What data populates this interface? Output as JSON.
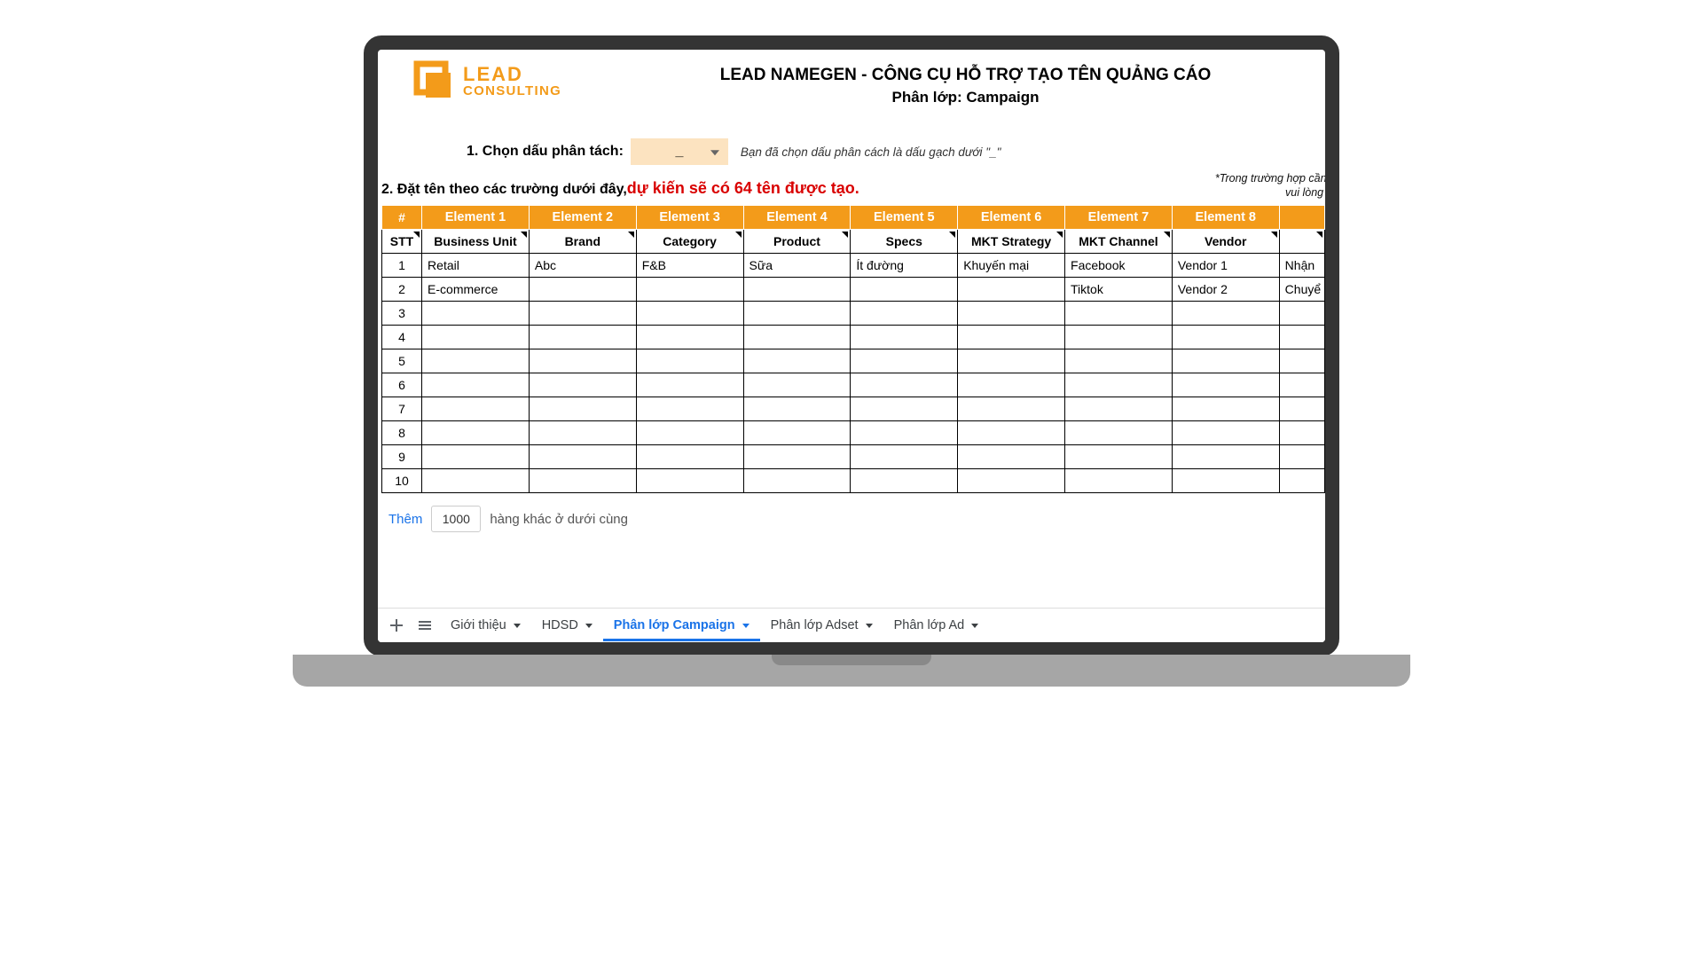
{
  "brand": {
    "line1": "LEAD",
    "line2": "CONSULTING"
  },
  "header": {
    "title": "LEAD NAMEGEN - CÔNG CỤ HỖ TRỢ TẠO TÊN QUẢNG CÁO",
    "subtitle": "Phân lớp: Campaign"
  },
  "step1": {
    "label": "1. Chọn dấu phân tách:",
    "separator_value": "_",
    "hint": "Bạn đã chọn dấu phân cách là dấu gạch dưới \"_\""
  },
  "step2": {
    "label": "2. Đặt tên theo các trường dưới đây, ",
    "highlight": "dự kiến sẽ có 64 tên được tạo.",
    "note_line1": "*Trong trường hợp cần p",
    "note_line2": "vui lòng th"
  },
  "table": {
    "header_hash": "#",
    "header_elements": [
      "Element 1",
      "Element 2",
      "Element 3",
      "Element 4",
      "Element 5",
      "Element 6",
      "Element 7",
      "Element 8",
      ""
    ],
    "header_stt": "STT",
    "header_fields": [
      "Business Unit",
      "Brand",
      "Category",
      "Product",
      "Specs",
      "MKT Strategy",
      "MKT Channel",
      "Vendor",
      ""
    ],
    "rows": [
      {
        "stt": "1",
        "cells": [
          "Retail",
          "Abc",
          "F&B",
          "Sữa",
          "Ít đường",
          "Khuyến mại",
          "Facebook",
          "Vendor 1",
          "Nhận "
        ]
      },
      {
        "stt": "2",
        "cells": [
          "E-commerce",
          "",
          "",
          "",
          "",
          "",
          "Tiktok",
          "Vendor 2",
          "Chuyể"
        ]
      },
      {
        "stt": "3",
        "cells": [
          "",
          "",
          "",
          "",
          "",
          "",
          "",
          "",
          ""
        ]
      },
      {
        "stt": "4",
        "cells": [
          "",
          "",
          "",
          "",
          "",
          "",
          "",
          "",
          ""
        ]
      },
      {
        "stt": "5",
        "cells": [
          "",
          "",
          "",
          "",
          "",
          "",
          "",
          "",
          ""
        ]
      },
      {
        "stt": "6",
        "cells": [
          "",
          "",
          "",
          "",
          "",
          "",
          "",
          "",
          ""
        ]
      },
      {
        "stt": "7",
        "cells": [
          "",
          "",
          "",
          "",
          "",
          "",
          "",
          "",
          ""
        ]
      },
      {
        "stt": "8",
        "cells": [
          "",
          "",
          "",
          "",
          "",
          "",
          "",
          "",
          ""
        ]
      },
      {
        "stt": "9",
        "cells": [
          "",
          "",
          "",
          "",
          "",
          "",
          "",
          "",
          ""
        ]
      },
      {
        "stt": "10",
        "cells": [
          "",
          "",
          "",
          "",
          "",
          "",
          "",
          "",
          ""
        ]
      }
    ]
  },
  "add_rows": {
    "link": "Thêm",
    "value": "1000",
    "suffix": "hàng khác ở dưới cùng"
  },
  "sheet_tabs": {
    "tabs": [
      {
        "label": "Giới thiệu",
        "active": false
      },
      {
        "label": "HDSD",
        "active": false
      },
      {
        "label": "Phân lớp Campaign",
        "active": true
      },
      {
        "label": "Phân lớp Adset",
        "active": false
      },
      {
        "label": "Phân lớp Ad",
        "active": false
      }
    ]
  }
}
